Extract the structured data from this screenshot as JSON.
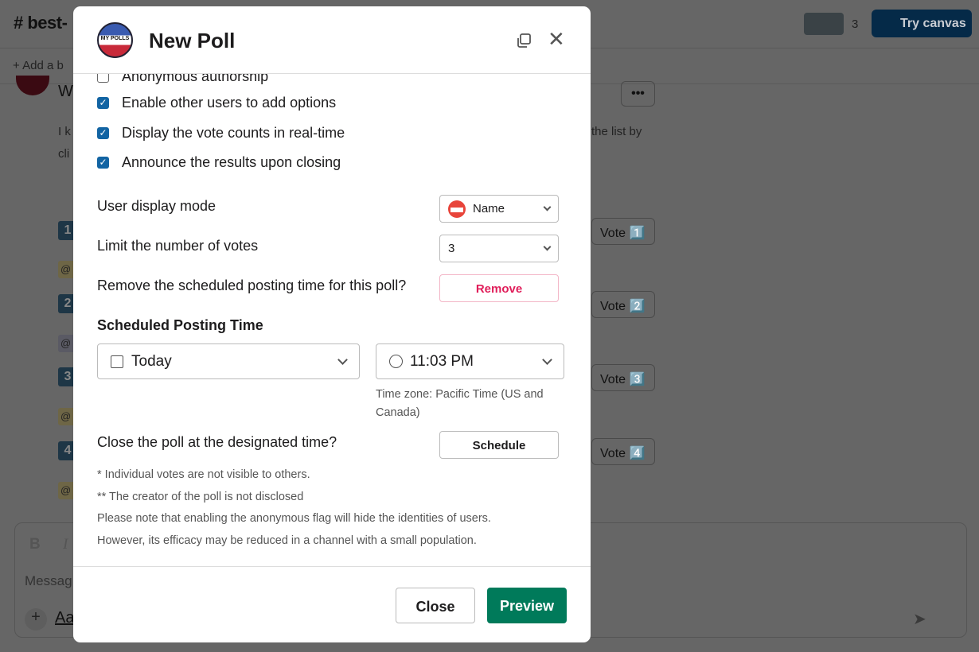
{
  "background": {
    "channel": "# best-",
    "bookmark": "+  Add a b",
    "member_count": "3",
    "try_canvas": "Try canvas",
    "more": "•••",
    "message_start": "W",
    "text_line1": "I k",
    "text_line1_end": "the list by",
    "text_line2": "cli",
    "votes": [
      "Vote 1️⃣",
      "Vote 2️⃣",
      "Vote 3️⃣",
      "Vote 4️⃣"
    ],
    "numbers": [
      "1",
      "2",
      "3",
      "4"
    ],
    "mention": "@",
    "composer_bold": "B",
    "composer_italic": "I",
    "composer_placeholder": "Messag",
    "composer_format": "Aa"
  },
  "modal": {
    "logo_text": "MY POLLS",
    "title": "New Poll",
    "options": [
      {
        "label": "Anonymous authorship",
        "checked": false
      },
      {
        "label": "Enable other users to add options",
        "checked": true
      },
      {
        "label": "Display the vote counts in real-time",
        "checked": true
      },
      {
        "label": "Announce the results upon closing",
        "checked": true
      }
    ],
    "user_display_mode": {
      "label": "User display mode",
      "value": "Name",
      "icon": "name-badge-icon"
    },
    "limit_votes": {
      "label": "Limit the number of votes",
      "value": "3"
    },
    "remove_schedule": {
      "label": "Remove the scheduled posting time for this poll?",
      "button": "Remove"
    },
    "scheduled": {
      "heading": "Scheduled Posting Time",
      "date": "Today",
      "time": "11:03 PM",
      "timezone": "Time zone: Pacific Time (US and Canada)"
    },
    "close_poll": {
      "label": "Close the poll at the designated time?",
      "button": "Schedule"
    },
    "notes": [
      "* Individual votes are not visible to others.",
      "** The creator of the poll is not disclosed",
      "Please note that enabling the anonymous flag will hide the identities of users.",
      "However, its efficacy may be reduced in a channel with a small population."
    ],
    "close_button": "Close",
    "preview_button": "Preview"
  },
  "colors": {
    "primary": "#007a5a",
    "danger": "#e01e5a",
    "checkbox": "#1264a3",
    "canvas": "#0b4c8c"
  }
}
